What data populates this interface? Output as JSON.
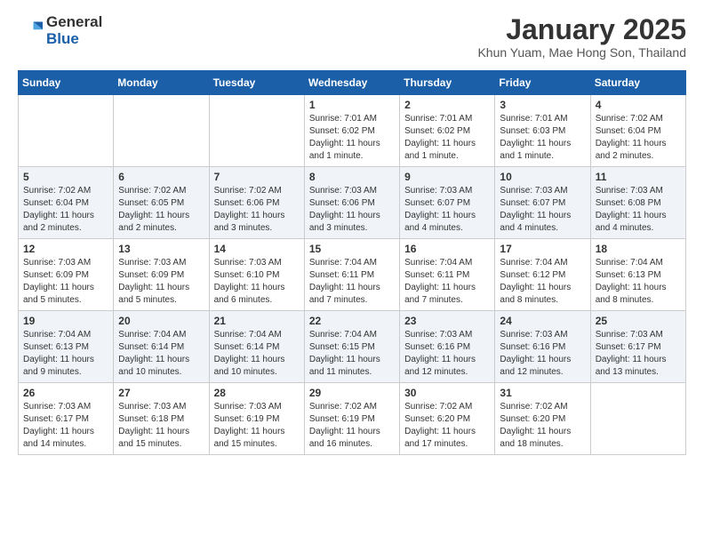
{
  "header": {
    "logo_general": "General",
    "logo_blue": "Blue",
    "month": "January 2025",
    "location": "Khun Yuam, Mae Hong Son, Thailand"
  },
  "days_of_week": [
    "Sunday",
    "Monday",
    "Tuesday",
    "Wednesday",
    "Thursday",
    "Friday",
    "Saturday"
  ],
  "weeks": [
    [
      {
        "day": "",
        "info": ""
      },
      {
        "day": "",
        "info": ""
      },
      {
        "day": "",
        "info": ""
      },
      {
        "day": "1",
        "info": "Sunrise: 7:01 AM\nSunset: 6:02 PM\nDaylight: 11 hours\nand 1 minute."
      },
      {
        "day": "2",
        "info": "Sunrise: 7:01 AM\nSunset: 6:02 PM\nDaylight: 11 hours\nand 1 minute."
      },
      {
        "day": "3",
        "info": "Sunrise: 7:01 AM\nSunset: 6:03 PM\nDaylight: 11 hours\nand 1 minute."
      },
      {
        "day": "4",
        "info": "Sunrise: 7:02 AM\nSunset: 6:04 PM\nDaylight: 11 hours\nand 2 minutes."
      }
    ],
    [
      {
        "day": "5",
        "info": "Sunrise: 7:02 AM\nSunset: 6:04 PM\nDaylight: 11 hours\nand 2 minutes."
      },
      {
        "day": "6",
        "info": "Sunrise: 7:02 AM\nSunset: 6:05 PM\nDaylight: 11 hours\nand 2 minutes."
      },
      {
        "day": "7",
        "info": "Sunrise: 7:02 AM\nSunset: 6:06 PM\nDaylight: 11 hours\nand 3 minutes."
      },
      {
        "day": "8",
        "info": "Sunrise: 7:03 AM\nSunset: 6:06 PM\nDaylight: 11 hours\nand 3 minutes."
      },
      {
        "day": "9",
        "info": "Sunrise: 7:03 AM\nSunset: 6:07 PM\nDaylight: 11 hours\nand 4 minutes."
      },
      {
        "day": "10",
        "info": "Sunrise: 7:03 AM\nSunset: 6:07 PM\nDaylight: 11 hours\nand 4 minutes."
      },
      {
        "day": "11",
        "info": "Sunrise: 7:03 AM\nSunset: 6:08 PM\nDaylight: 11 hours\nand 4 minutes."
      }
    ],
    [
      {
        "day": "12",
        "info": "Sunrise: 7:03 AM\nSunset: 6:09 PM\nDaylight: 11 hours\nand 5 minutes."
      },
      {
        "day": "13",
        "info": "Sunrise: 7:03 AM\nSunset: 6:09 PM\nDaylight: 11 hours\nand 5 minutes."
      },
      {
        "day": "14",
        "info": "Sunrise: 7:03 AM\nSunset: 6:10 PM\nDaylight: 11 hours\nand 6 minutes."
      },
      {
        "day": "15",
        "info": "Sunrise: 7:04 AM\nSunset: 6:11 PM\nDaylight: 11 hours\nand 7 minutes."
      },
      {
        "day": "16",
        "info": "Sunrise: 7:04 AM\nSunset: 6:11 PM\nDaylight: 11 hours\nand 7 minutes."
      },
      {
        "day": "17",
        "info": "Sunrise: 7:04 AM\nSunset: 6:12 PM\nDaylight: 11 hours\nand 8 minutes."
      },
      {
        "day": "18",
        "info": "Sunrise: 7:04 AM\nSunset: 6:13 PM\nDaylight: 11 hours\nand 8 minutes."
      }
    ],
    [
      {
        "day": "19",
        "info": "Sunrise: 7:04 AM\nSunset: 6:13 PM\nDaylight: 11 hours\nand 9 minutes."
      },
      {
        "day": "20",
        "info": "Sunrise: 7:04 AM\nSunset: 6:14 PM\nDaylight: 11 hours\nand 10 minutes."
      },
      {
        "day": "21",
        "info": "Sunrise: 7:04 AM\nSunset: 6:14 PM\nDaylight: 11 hours\nand 10 minutes."
      },
      {
        "day": "22",
        "info": "Sunrise: 7:04 AM\nSunset: 6:15 PM\nDaylight: 11 hours\nand 11 minutes."
      },
      {
        "day": "23",
        "info": "Sunrise: 7:03 AM\nSunset: 6:16 PM\nDaylight: 11 hours\nand 12 minutes."
      },
      {
        "day": "24",
        "info": "Sunrise: 7:03 AM\nSunset: 6:16 PM\nDaylight: 11 hours\nand 12 minutes."
      },
      {
        "day": "25",
        "info": "Sunrise: 7:03 AM\nSunset: 6:17 PM\nDaylight: 11 hours\nand 13 minutes."
      }
    ],
    [
      {
        "day": "26",
        "info": "Sunrise: 7:03 AM\nSunset: 6:17 PM\nDaylight: 11 hours\nand 14 minutes."
      },
      {
        "day": "27",
        "info": "Sunrise: 7:03 AM\nSunset: 6:18 PM\nDaylight: 11 hours\nand 15 minutes."
      },
      {
        "day": "28",
        "info": "Sunrise: 7:03 AM\nSunset: 6:19 PM\nDaylight: 11 hours\nand 15 minutes."
      },
      {
        "day": "29",
        "info": "Sunrise: 7:02 AM\nSunset: 6:19 PM\nDaylight: 11 hours\nand 16 minutes."
      },
      {
        "day": "30",
        "info": "Sunrise: 7:02 AM\nSunset: 6:20 PM\nDaylight: 11 hours\nand 17 minutes."
      },
      {
        "day": "31",
        "info": "Sunrise: 7:02 AM\nSunset: 6:20 PM\nDaylight: 11 hours\nand 18 minutes."
      },
      {
        "day": "",
        "info": ""
      }
    ]
  ]
}
